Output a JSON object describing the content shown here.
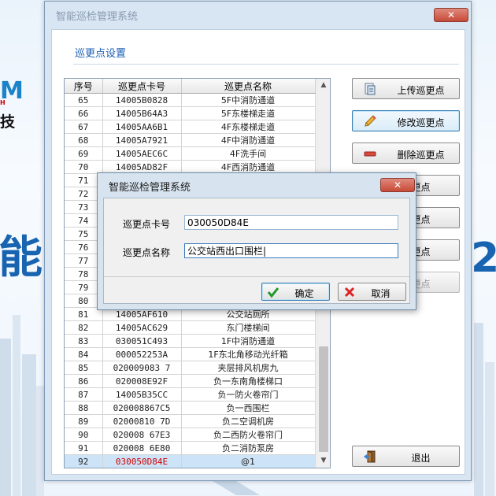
{
  "background": {
    "logo_text": "M",
    "tagline": "H",
    "left_char": "技",
    "big_left": "能",
    "big_right": "2"
  },
  "main_window": {
    "title": "智能巡检管理系统",
    "close_symbol": "✕",
    "section_title": "巡更点设置",
    "table": {
      "columns": [
        "序号",
        "巡更点卡号",
        "巡更点名称"
      ],
      "rows": [
        [
          "65",
          "14005B0828",
          "5F中消防通道"
        ],
        [
          "66",
          "14005B64A3",
          "5F东楼梯走道"
        ],
        [
          "67",
          "14005AA6B1",
          "4F东楼梯走道"
        ],
        [
          "68",
          "14005A7921",
          "4F中消防通道"
        ],
        [
          "69",
          "14005AEC6C",
          "4F洗手间"
        ],
        [
          "70",
          "14005AD82F",
          "4F西消防通道"
        ],
        [
          "71",
          "",
          ""
        ],
        [
          "72",
          "",
          ""
        ],
        [
          "73",
          "",
          ""
        ],
        [
          "74",
          "",
          ""
        ],
        [
          "75",
          "",
          ""
        ],
        [
          "76",
          "",
          ""
        ],
        [
          "77",
          "",
          ""
        ],
        [
          "78",
          "",
          ""
        ],
        [
          "79",
          "",
          ""
        ],
        [
          "80",
          "",
          ""
        ],
        [
          "81",
          "14005AF610",
          "公交站厕所"
        ],
        [
          "82",
          "14005AC629",
          "东门楼梯间"
        ],
        [
          "83",
          "030051C493",
          "1F中消防通道"
        ],
        [
          "84",
          "000052253A",
          "1F东北角移动光纤箱"
        ],
        [
          "85",
          "020009083 7",
          "夹层排风机房九"
        ],
        [
          "86",
          "020008E92F",
          "负一东南角楼梯口"
        ],
        [
          "87",
          "14005B35CC",
          "负一防火卷帘门"
        ],
        [
          "88",
          "020008867C5",
          "负一西围栏"
        ],
        [
          "89",
          "02000810 7D",
          "负二空调机房"
        ],
        [
          "90",
          "020008 67E3",
          "负二西防火卷帘门"
        ],
        [
          "91",
          "020008 6E80",
          "负二消防泵房"
        ],
        [
          "92",
          "030050D84E",
          "@1"
        ]
      ],
      "selected_row": 27
    },
    "buttons": {
      "upload": "上传巡更点",
      "edit": "修改巡更点",
      "delete": "删除巡更点",
      "partial_1": "更点",
      "partial_2": "更点",
      "partial_3": "更点",
      "partial_4": "更点",
      "exit": "退出"
    }
  },
  "dialog": {
    "title": "智能巡检管理系统",
    "close_symbol": "✕",
    "card_label": "巡更点卡号",
    "card_value": "030050D84E",
    "name_label": "巡更点名称",
    "name_value": "公交站西出口围栏|",
    "ok_label": "确定",
    "cancel_label": "取消"
  },
  "colors": {
    "accent": "#1c5fb3",
    "selected_text": "#d00000",
    "close_button": "#c74a38"
  }
}
